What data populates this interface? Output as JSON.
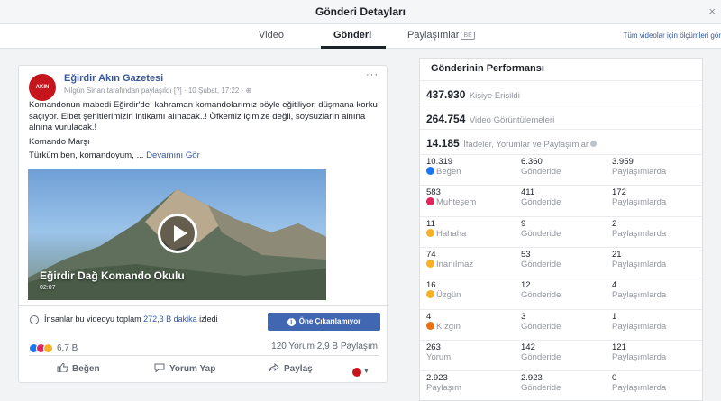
{
  "window": {
    "title": "Gönderi Detayları",
    "close_label": "×"
  },
  "tabs": [
    {
      "label": "Video"
    },
    {
      "label": "Gönderi"
    },
    {
      "label": "Paylaşımlar",
      "badge": "BE"
    }
  ],
  "all_videos_link": "Tüm videolar için ölçümleri gör",
  "post": {
    "avatar_text": "AKIN",
    "page_name": "Eğirdir Akın Gazetesi",
    "subline": "Nilgün Sinan tarafından paylaşıldı [?] · 10 Şubat, 17:22 · ⊕",
    "more": "···",
    "text_lines": [
      "Komandonun mabedi Eğirdir'de, kahraman komandolarımız böyle eğitiliyor, düşmana korku saçıyor. Elbet şehitlerimizin intikamı alınacak..! Öfkemiz içimize değil, soysuzların alnına alnına vurulacak.!",
      "Komando Marşı"
    ],
    "last_line": "Türküm ben, komandoyum, ...",
    "see_more": "Devamını Gör",
    "video": {
      "title": "Eğirdir Dağ Komando Okulu",
      "duration": "02:07"
    },
    "minutes": {
      "prefix": "İnsanlar bu videoyu toplam",
      "value": "272,3 B dakika",
      "suffix": "izledi"
    },
    "promote_button": "Öne Çıkarılamıyor",
    "reaction_count": "6,7 B",
    "comments_shares": "120 Yorum 2,9 B Paylaşım",
    "actions": {
      "like": "Beğen",
      "comment": "Yorum Yap",
      "share": "Paylaş"
    }
  },
  "performance": {
    "title": "Gönderinin Performansı",
    "reach": {
      "value": "437.930",
      "label": "Kişiye Erişildi"
    },
    "views": {
      "value": "264.754",
      "label": "Video Görüntülemeleri"
    },
    "engagement": {
      "value": "14.185",
      "label": "İfadeler, Yorumlar ve Paylaşımlar"
    },
    "col_post": "Gönderide",
    "col_shares": "Paylaşımlarda",
    "rows": [
      {
        "total": "10.319",
        "name": "Beğen",
        "icon": "like-icon",
        "post": "6.360",
        "shares": "3.959",
        "color": "#1877f2"
      },
      {
        "total": "583",
        "name": "Muhteşem",
        "icon": "love-icon",
        "post": "411",
        "shares": "172",
        "color": "#e0245e"
      },
      {
        "total": "11",
        "name": "Hahaha",
        "icon": "haha-icon",
        "post": "9",
        "shares": "2",
        "color": "#f7b125"
      },
      {
        "total": "74",
        "name": "İnanılmaz",
        "icon": "wow-icon",
        "post": "53",
        "shares": "21",
        "color": "#f7b125"
      },
      {
        "total": "16",
        "name": "Üzgün",
        "icon": "sad-icon",
        "post": "12",
        "shares": "4",
        "color": "#f7b125"
      },
      {
        "total": "4",
        "name": "Kızgın",
        "icon": "angry-icon",
        "post": "3",
        "shares": "1",
        "color": "#e9710f"
      },
      {
        "total": "263",
        "name": "Yorum",
        "icon": "",
        "post": "142",
        "shares": "121",
        "color": ""
      },
      {
        "total": "2.923",
        "name": "Paylaşım",
        "icon": "",
        "post": "2.923",
        "shares": "0",
        "color": ""
      }
    ]
  }
}
